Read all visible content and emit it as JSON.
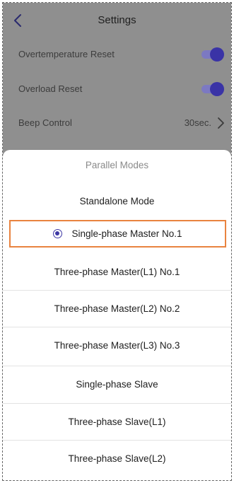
{
  "header": {
    "title": "Settings"
  },
  "settings": {
    "overtemp_label": "Overtemperature Reset",
    "overload_label": "Overload Reset",
    "beep_label": "Beep Control",
    "beep_value": "30sec."
  },
  "sheet": {
    "title": "Parallel Modes",
    "options": [
      "Standalone Mode",
      "Single-phase Master No.1",
      "Three-phase Master(L1) No.1",
      "Three-phase Master(L2) No.2",
      "Three-phase Master(L3) No.3",
      "Single-phase Slave",
      "Three-phase Slave(L1)",
      "Three-phase Slave(L2)"
    ],
    "selected_option": "Single-phase Master No.1"
  },
  "colors": {
    "accent": "#3a33a6",
    "highlight": "#e9833f",
    "overlay": "#8f8f8f"
  }
}
